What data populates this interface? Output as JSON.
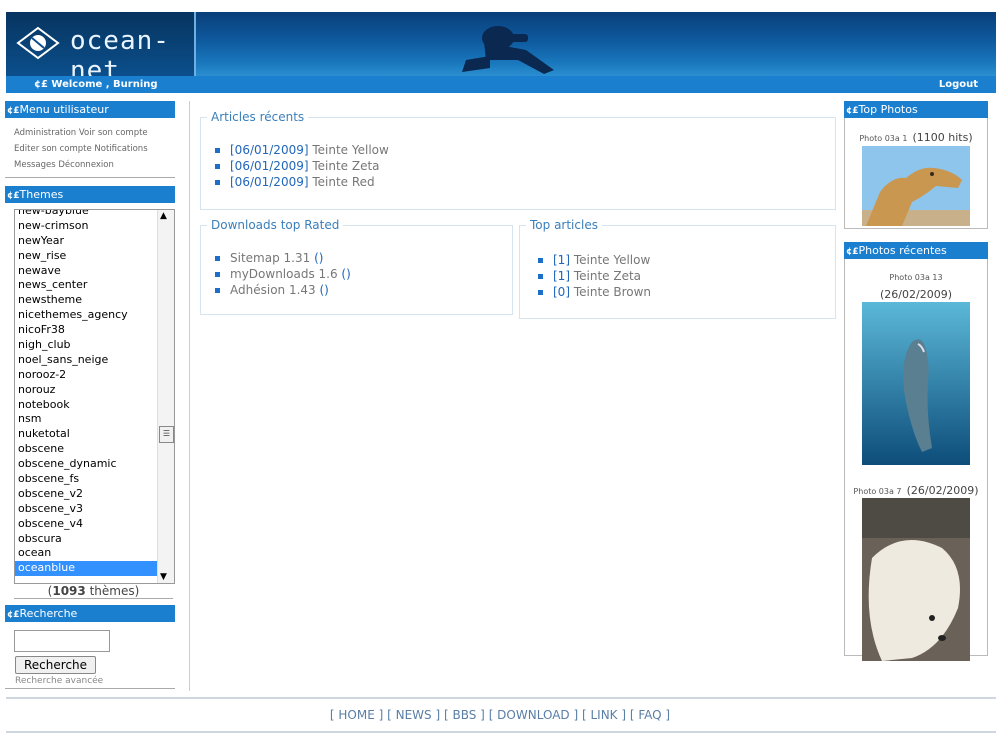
{
  "header": {
    "logo_text": "ocean-net",
    "welcome_prefix": "¢£",
    "welcome_text": "Welcome , Burning",
    "logout": "Logout"
  },
  "blocks": {
    "menu": {
      "title_prefix": "¢£",
      "title": "Menu utilisateur",
      "links": [
        "Administration",
        "Voir son compte",
        "Editer son compte",
        "Notifications",
        "Messages",
        "Déconnexion"
      ]
    },
    "themes": {
      "title_prefix": "¢£",
      "title": "Themes",
      "items": [
        "new-bayblue",
        "new-crimson",
        "newYear",
        "new_rise",
        "newave",
        "news_center",
        "newstheme",
        "nicethemes_agency",
        "nicoFr38",
        "nigh_club",
        "noel_sans_neige",
        "norooz-2",
        "norouz",
        "notebook",
        "nsm",
        "nuketotal",
        "obscene",
        "obscene_dynamic",
        "obscene_fs",
        "obscene_v2",
        "obscene_v3",
        "obscene_v4",
        "obscura",
        "ocean",
        "oceanblue"
      ],
      "selected": "oceanblue",
      "count": "1093",
      "count_suffix": "thèmes"
    },
    "search": {
      "title_prefix": "¢£",
      "title": "Recherche",
      "placeholder": "",
      "button": "Recherche",
      "advanced": "Recherche avancée"
    }
  },
  "main": {
    "recent_articles": {
      "title": "Articles récents",
      "items": [
        {
          "date": "[06/01/2009]",
          "name": "Teinte Yellow"
        },
        {
          "date": "[06/01/2009]",
          "name": "Teinte Zeta"
        },
        {
          "date": "[06/01/2009]",
          "name": "Teinte Red"
        }
      ]
    },
    "downloads": {
      "title": "Downloads top Rated",
      "items": [
        {
          "name": "Sitemap 1.31",
          "paren": "()"
        },
        {
          "name": "myDownloads 1.6",
          "paren": "()"
        },
        {
          "name": "Adhésion 1.43",
          "paren": "()"
        }
      ]
    },
    "top_articles": {
      "title": "Top articles",
      "items": [
        {
          "rank": "[1]",
          "name": "Teinte Yellow"
        },
        {
          "rank": "[1]",
          "name": "Teinte Zeta"
        },
        {
          "rank": "[0]",
          "name": "Teinte Brown"
        }
      ]
    }
  },
  "right": {
    "top_photos": {
      "title_prefix": "¢£",
      "title": "Top Photos",
      "label": "Photo 03a 1",
      "meta": "(1100 hits)"
    },
    "recent_photos": {
      "title_prefix": "¢£",
      "title": "Photos récentes",
      "p1_label": "Photo 03a 13",
      "p1_meta": "(26/02/2009)",
      "p2_label": "Photo 03a 7",
      "p2_meta": "(26/02/2009)"
    }
  },
  "footer": [
    "[ HOME ]",
    "[ NEWS ]",
    "[ BBS ]",
    "[ DOWNLOAD ]",
    "[ LINK ]",
    "[ FAQ ]"
  ],
  "colors": {
    "accent": "#1b7fd0",
    "link": "#2266bb"
  }
}
